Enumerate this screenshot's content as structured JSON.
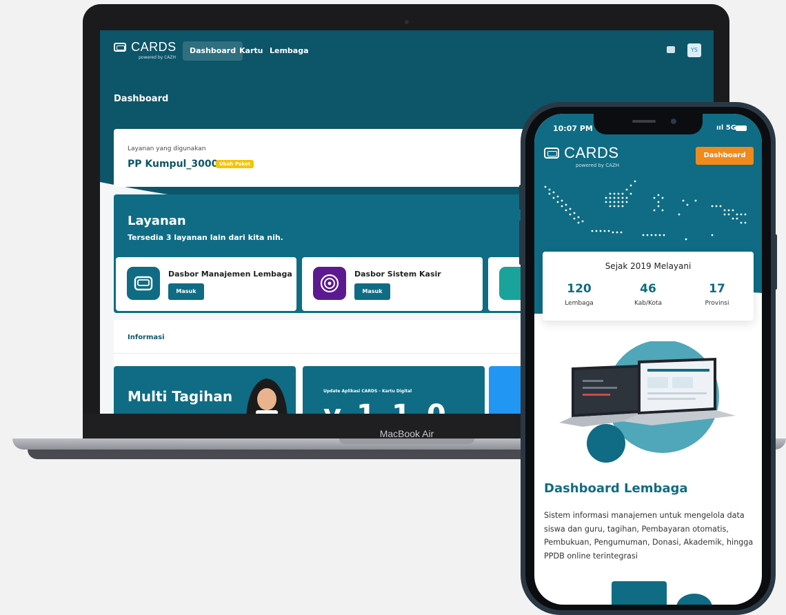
{
  "laptop": {
    "brand": "MacBook Air",
    "screen": {
      "logo": {
        "brand": "CARDS",
        "tagline": "powered by CAZH"
      },
      "nav": [
        {
          "label": "Dashboard",
          "active": true
        },
        {
          "label": "Kartu",
          "active": false
        },
        {
          "label": "Lembaga",
          "active": false
        }
      ],
      "user_initials": "YS",
      "page_title": "Dashboard",
      "service_card": {
        "label": "Layanan yang digunakan",
        "value": "PP Kumpul_3000",
        "badge": "Ubah Paket"
      },
      "layanan": {
        "title": "Layanan",
        "subtitle_prefix": "Tersedia ",
        "subtitle_count": "3",
        "subtitle_suffix": " layanan lain dari kita nih.",
        "items": [
          {
            "name": "Dasbor Manajemen Lembaga",
            "button": "Masuk",
            "icon": "cards-app-icon",
            "color": "#0f6c84"
          },
          {
            "name": "Dasbor Sistem Kasir",
            "button": "Masuk",
            "icon": "kasir-app-icon",
            "color": "#5b1a8f"
          }
        ]
      },
      "informasi": {
        "title": "Informasi",
        "banners": [
          {
            "text": "Multi Tagihan"
          },
          {
            "small": "Update Aplikasi CARDS - Kartu Digital",
            "version": "v 1.1.0"
          }
        ]
      }
    }
  },
  "phone": {
    "time": "10:07 PM",
    "signal": "5G",
    "logo": {
      "brand": "CARDS",
      "tagline": "powered by CAZH"
    },
    "dashboard_button": "Dashboard",
    "stats": {
      "title": "Sejak 2019 Melayani",
      "items": [
        {
          "value": "120",
          "label": "Lembaga"
        },
        {
          "value": "46",
          "label": "Kab/Kota"
        },
        {
          "value": "17",
          "label": "Provinsi"
        }
      ]
    },
    "heading": "Dashboard Lembaga",
    "description": "Sistem informasi manajemen untuk mengelola data siswa dan guru, tagihan, Pembayaran otomatis, Pembukuan, Pengumuman, Donasi, Akademik, hingga PPDB online terintegrasi"
  },
  "colors": {
    "primary": "#0f6c84",
    "dark_teal": "#0d5569",
    "accent_orange": "#f08a1c",
    "badge_yellow": "#f5c400"
  }
}
